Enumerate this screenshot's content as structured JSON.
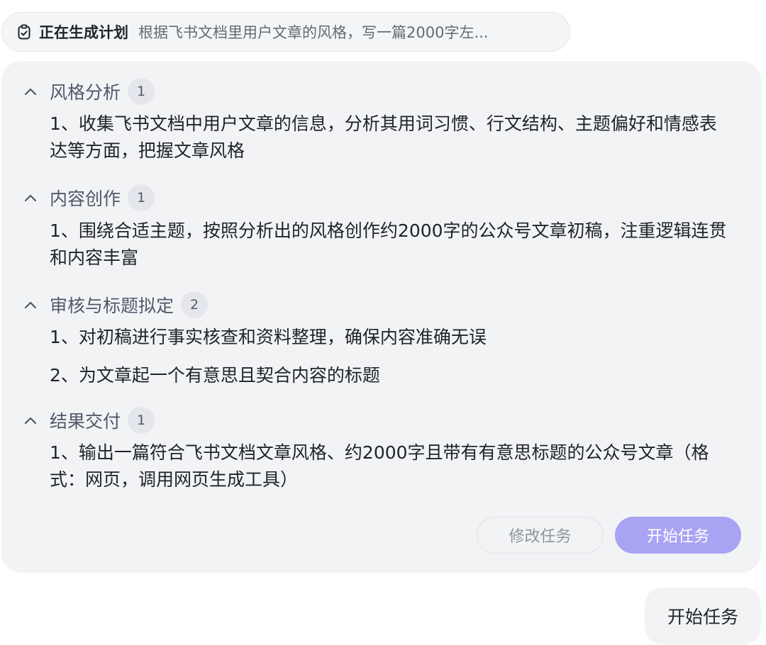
{
  "header": {
    "icon": "clipboard-check-icon",
    "status_label": "正在生成计划",
    "prompt_preview": "根据飞书文档里用户文章的风格，写一篇2000字左..."
  },
  "plan": {
    "sections": [
      {
        "title": "风格分析",
        "count": "1",
        "items": [
          "1、收集飞书文档中用户文章的信息，分析其用词习惯、行文结构、主题偏好和情感表达等方面，把握文章风格"
        ]
      },
      {
        "title": "内容创作",
        "count": "1",
        "items": [
          "1、围绕合适主题，按照分析出的风格创作约2000字的公众号文章初稿，注重逻辑连贯和内容丰富"
        ]
      },
      {
        "title": "审核与标题拟定",
        "count": "2",
        "items": [
          "1、对初稿进行事实核查和资料整理，确保内容准确无误",
          "2、为文章起一个有意思且契合内容的标题"
        ]
      },
      {
        "title": "结果交付",
        "count": "1",
        "items": [
          "1、输出一篇符合飞书文档文章风格、约2000字且带有有意思标题的公众号文章（格式：网页，调用网页生成工具）"
        ]
      }
    ],
    "edit_button_label": "修改任务",
    "start_button_label": "开始任务"
  },
  "user_message": "开始任务",
  "colors": {
    "accent": "#a9a3f4",
    "card_background": "#f2f3f5",
    "section_title": "#4e5969"
  }
}
